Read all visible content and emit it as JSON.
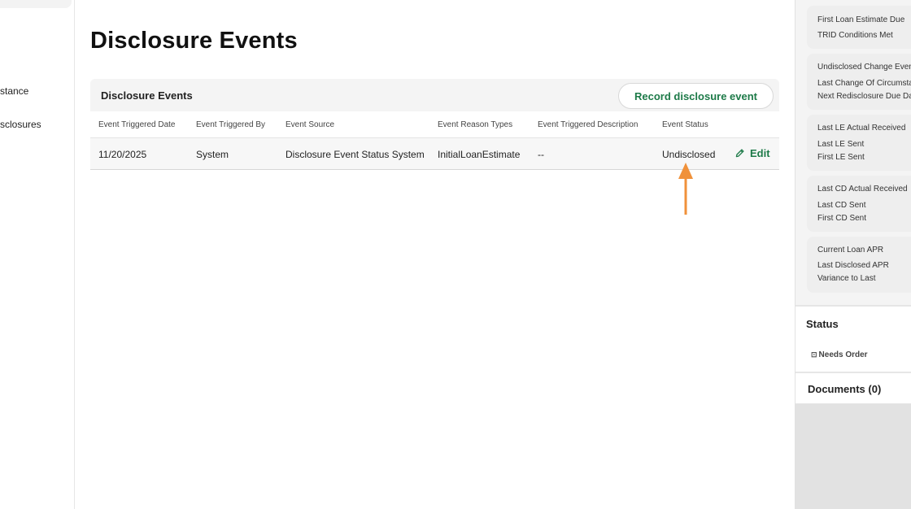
{
  "sidebar": {
    "items": [
      {
        "label": "stance"
      },
      {
        "label": "sclosures"
      }
    ]
  },
  "page": {
    "title": "Disclosure Events"
  },
  "events_card": {
    "title": "Disclosure Events",
    "record_button": "Record disclosure event",
    "columns": [
      "Event Triggered Date",
      "Event Triggered By",
      "Event Source",
      "Event Reason Types",
      "Event Triggered Description",
      "Event Status"
    ],
    "rows": [
      {
        "date": "11/20/2025",
        "triggered_by": "System",
        "source": "Disclosure Event Status System",
        "reason_types": "InitialLoanEstimate",
        "description": "--",
        "status": "Undisclosed",
        "edit_label": "Edit"
      }
    ]
  },
  "right_panel": {
    "cards": [
      {
        "lines": [
          "First Loan Estimate Due",
          "TRID Conditions Met"
        ]
      },
      {
        "lines": [
          "Undisclosed Change Even",
          "Last Change Of Circumsta",
          "Next Redisclosure Due Da"
        ]
      },
      {
        "lines": [
          "Last LE Actual Received",
          "Last LE Sent",
          "First LE Sent"
        ]
      },
      {
        "lines": [
          "Last CD Actual Received",
          "Last CD Sent",
          "First CD Sent"
        ]
      },
      {
        "lines": [
          "Current Loan APR",
          "Last Disclosed APR",
          "Variance to Last"
        ]
      }
    ],
    "status": {
      "title": "Status",
      "needs_order": "Needs Order"
    },
    "documents": {
      "title": "Documents (0)"
    }
  },
  "colors": {
    "accent_green": "#1d7a48",
    "link_green": "#2f8a57",
    "annotation_orange": "#f0913a"
  },
  "icons": {
    "edit": "pencil-icon",
    "annotation": "arrow-up-icon",
    "needs_order": "checkbox-icon"
  }
}
